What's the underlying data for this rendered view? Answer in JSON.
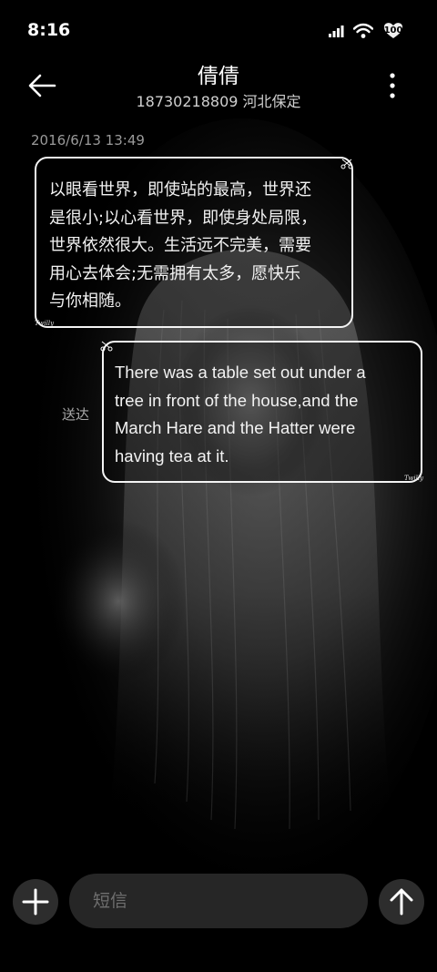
{
  "status_bar": {
    "time": "8:16",
    "battery": "100",
    "icons": [
      "signal-icon",
      "wifi-icon",
      "battery-icon"
    ]
  },
  "header": {
    "contact_name": "倩倩",
    "contact_sub": "18730218809 河北保定",
    "back_icon": "back-arrow-icon",
    "more_icon": "more-vertical-icon"
  },
  "conversation": {
    "timestamp": "2016/6/13 13:49",
    "messages": [
      {
        "direction": "incoming",
        "text": "以眼看世界，即使站的最高，世界还\n是很小;以心看世界，即使身处局限，\n世界依然很大。生活远不完美，需要\n用心去体会;无需拥有太多，愿快乐\n与你相随。",
        "signature": "Twilly"
      },
      {
        "direction": "outgoing",
        "lines": [
          "There was a table set out under a",
          "tree in front of the house,and the",
          "March Hare and the Hatter were",
          "having tea at it."
        ],
        "signature": "Twilly"
      }
    ],
    "delivered_label": "送达"
  },
  "composer": {
    "placeholder": "短信",
    "value": "",
    "plus_icon": "plus-icon",
    "send_icon": "send-arrow-icon"
  },
  "colors": {
    "background": "#000000",
    "bubble_border": "#f4f4f4",
    "control_bg": "#2d2d2d",
    "input_bg": "#262626"
  }
}
